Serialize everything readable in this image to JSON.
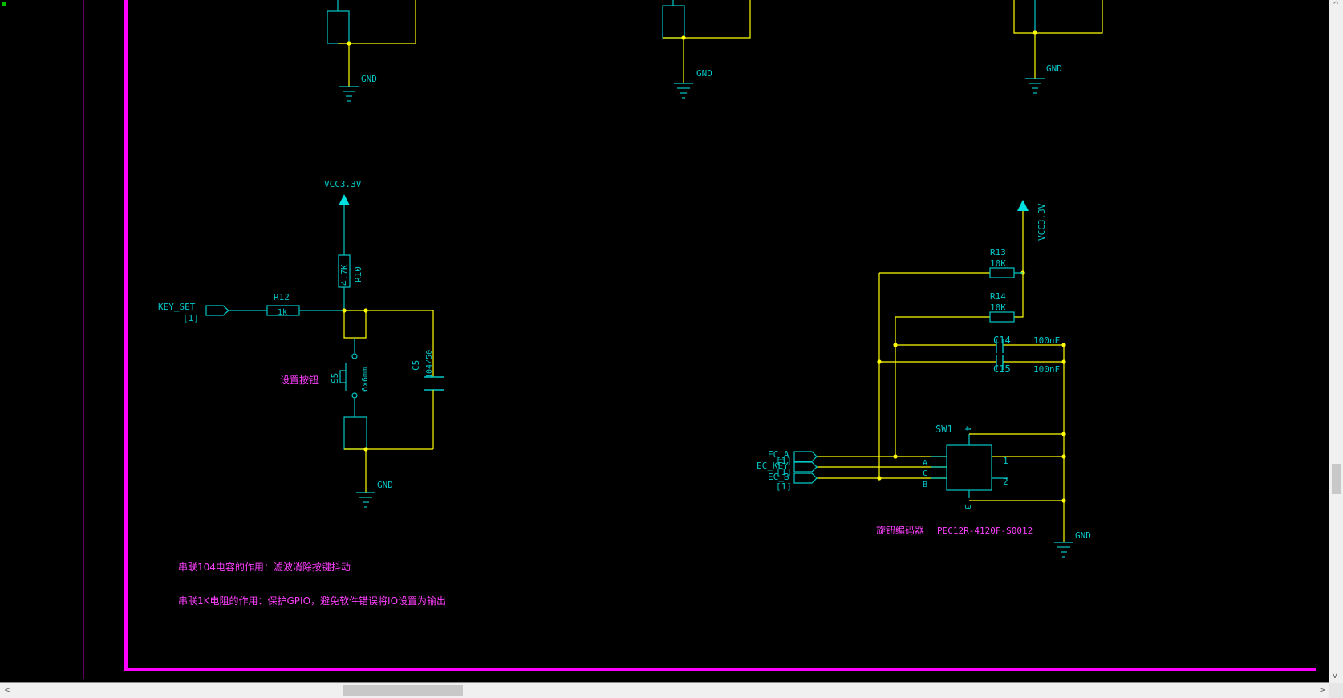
{
  "colors": {
    "background": "#000000",
    "border": "#ff00ff",
    "wire": "#ffff00",
    "component": "#00c8c8",
    "text": "#00c8c8",
    "comment": "#ff40ff"
  },
  "top_grounds": [
    {
      "label": "GND"
    },
    {
      "label": "GND"
    },
    {
      "label": "GND"
    }
  ],
  "key_circuit": {
    "vcc_label": "VCC3.3V",
    "net_label": "KEY_SET",
    "net_ref": "[1]",
    "r12_ref": "R12",
    "r12_value": "1k",
    "r10_ref": "R10",
    "r10_value": "4.7K",
    "c5_ref": "C5",
    "c5_value": "104/50",
    "s5_ref": "S5",
    "s5_size": "6x6mm",
    "s5_desc": "设置按钮",
    "gnd_label": "GND"
  },
  "encoder_circuit": {
    "vcc_label": "VCC3.3V",
    "r13_ref": "R13",
    "r13_value": "10K",
    "r14_ref": "R14",
    "r14_value": "10K",
    "c14_ref": "C14",
    "c14_value": "100nF",
    "c15_ref": "C15",
    "c15_value": "100nF",
    "sw1_ref": "SW1",
    "pin_a": "A",
    "pin_c": "C",
    "pin_b": "B",
    "pin_1": "1",
    "pin_2": "2",
    "pin_3": "3",
    "pin_4": "4",
    "net_a": "EC_A",
    "net_key": "EC_KEY",
    "net_b": "EC_B",
    "net_ref": "[1]",
    "desc": "旋钮编码器",
    "part": "PEC12R-4120F-S0012",
    "gnd_label": "GND"
  },
  "notes": [
    "串联104电容的作用：滤波消除按键抖动",
    "串联1K电阻的作用：保护GPIO，避免软件错误将IO设置为输出"
  ],
  "scrollbar": {
    "left_arrow": "<",
    "right_arrow": ">",
    "up_arrow": "^",
    "down_arrow": "v"
  }
}
